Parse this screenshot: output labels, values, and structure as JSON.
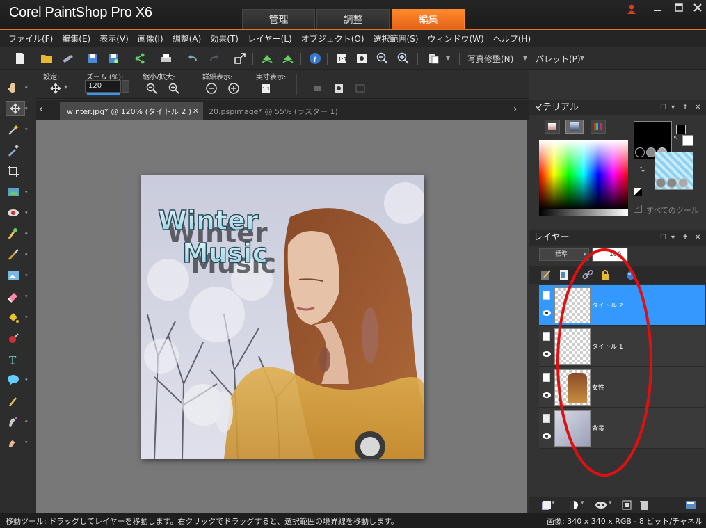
{
  "app": {
    "title": "Corel PaintShop Pro X6",
    "workspace_tabs": [
      "管理",
      "調整",
      "編集"
    ],
    "active_tab": "編集"
  },
  "menu": [
    "ファイル(F)",
    "編集(E)",
    "表示(V)",
    "画像(I)",
    "調整(A)",
    "効果(T)",
    "レイヤー(L)",
    "オブジェクト(O)",
    "選択範囲(S)",
    "ウィンドウ(W)",
    "ヘルプ(H)"
  ],
  "toolbar": {
    "photo_fix": "写真修整(N)",
    "palette": "パレット(P)"
  },
  "options": {
    "preset_label": "設定:",
    "zoom_label": "ズーム (%):",
    "zoom_value": "120",
    "zoom_out_in_label": "縮小/拡大:",
    "detail_label": "詳細表示:",
    "actual_label": "実寸表示:"
  },
  "documents": [
    {
      "title": "winter.jpg* @ 120% (タイトル 2 )",
      "active": true
    },
    {
      "title": "20.pspimage* @  55% (ラスター 1)",
      "active": false
    }
  ],
  "artwork": {
    "line1": "Winter",
    "line2": "Music"
  },
  "materials": {
    "title": "マテリアル",
    "all_tools": "すべてのツール",
    "foreground": "#000000",
    "background": "#ffffff"
  },
  "layers": {
    "title": "レイヤー",
    "blend_mode": "標準",
    "opacity": "100",
    "items": [
      {
        "name": "タイトル 2",
        "selected": true
      },
      {
        "name": "タイトル 1",
        "selected": false
      },
      {
        "name": "女性",
        "selected": false
      },
      {
        "name": "背景",
        "selected": false
      }
    ]
  },
  "status": {
    "message": "移動ツール: ドラッグしてレイヤーを移動します。右クリックでドラッグすると、選択範囲の境界線を移動します。",
    "image_info": "画像: 340 x 340 x RGB - 8 ビット/チャネル"
  },
  "colors": {
    "accent": "#e8701e",
    "selection": "#3399ff",
    "annotation": "#e01010"
  }
}
